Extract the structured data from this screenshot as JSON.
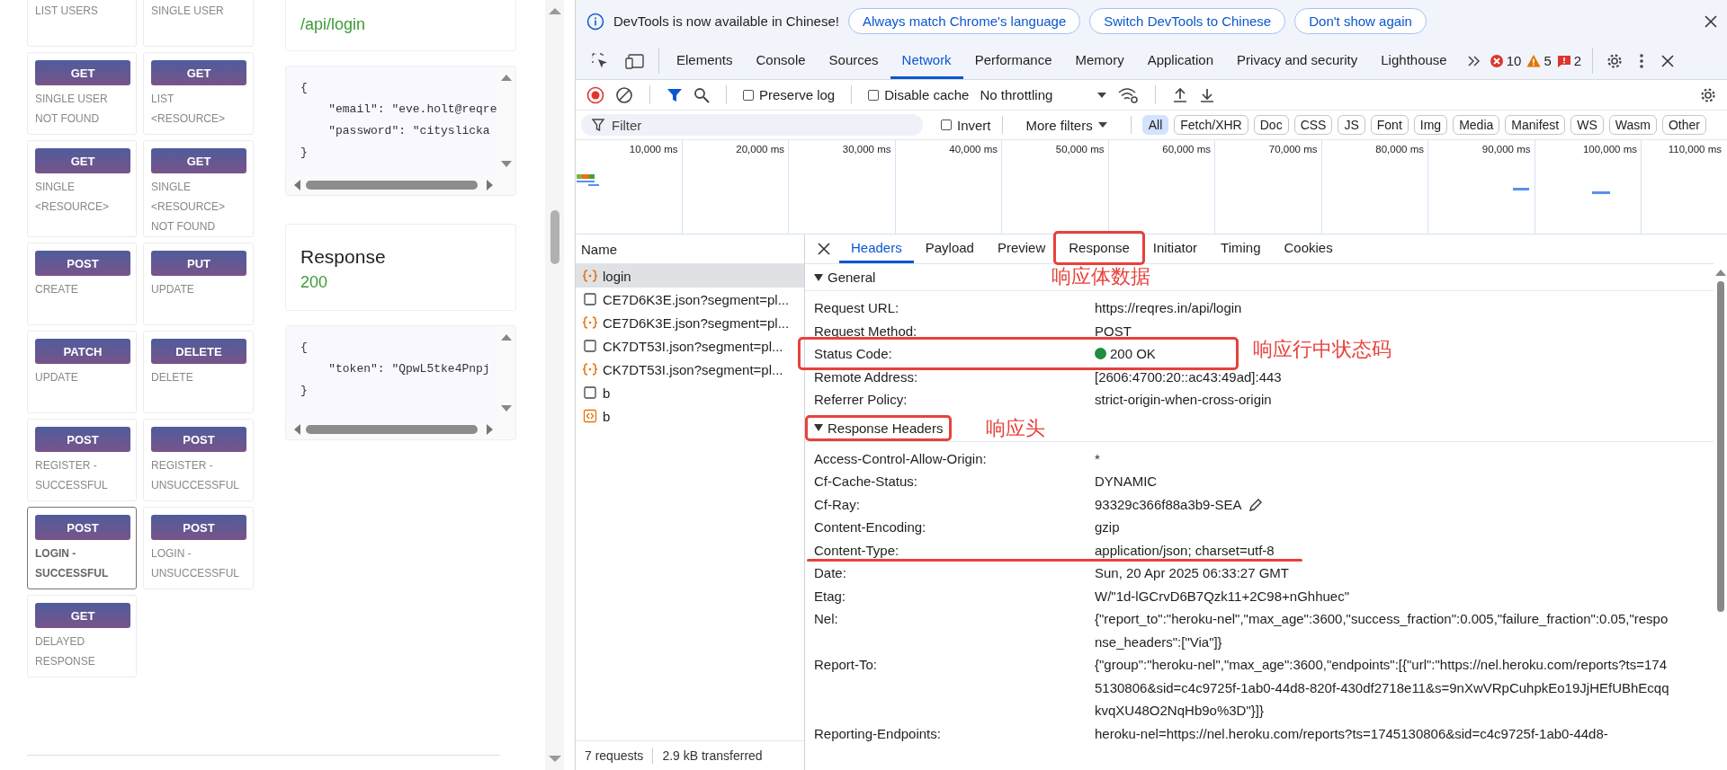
{
  "page": {
    "cards": [
      {
        "lines": "LIST USERS",
        "selected": false
      },
      {
        "lines": "SINGLE USER",
        "selected": false
      },
      {
        "method": "GET",
        "lines": "SINGLE USER NOT FOUND",
        "selected": false
      },
      {
        "method": "GET",
        "lines": "LIST <RESOURCE>",
        "selected": false
      },
      {
        "method": "GET",
        "lines": "SINGLE <RESOURCE>",
        "selected": false
      },
      {
        "method": "GET",
        "lines": "SINGLE <RESOURCE> NOT FOUND",
        "selected": false
      },
      {
        "method": "POST",
        "lines": "CREATE",
        "selected": false
      },
      {
        "method": "PUT",
        "lines": "UPDATE",
        "selected": false
      },
      {
        "method": "PATCH",
        "lines": "UPDATE",
        "selected": false
      },
      {
        "method": "DELETE",
        "lines": "DELETE",
        "selected": false
      },
      {
        "method": "POST",
        "lines": "REGISTER - SUCCESSFUL",
        "selected": false
      },
      {
        "method": "POST",
        "lines": "REGISTER - UNSUCCESSFUL",
        "selected": false
      },
      {
        "method": "POST",
        "lines": "LOGIN - SUCCESSFUL",
        "selected": true
      },
      {
        "method": "POST",
        "lines": "LOGIN - UNSUCCESSFUL",
        "selected": false
      },
      {
        "method": "GET",
        "lines": "DELAYED RESPONSE",
        "selected": false
      }
    ],
    "request": {
      "path": "/api/login",
      "body": [
        "{",
        "    \"email\": \"eve.holt@reqre",
        "    \"password\": \"cityslicka",
        "}"
      ]
    },
    "response": {
      "title": "Response",
      "status": "200",
      "body": [
        "{",
        "    \"token\": \"QpwL5tke4Pnpj",
        "}"
      ]
    }
  },
  "devtools": {
    "infobar": {
      "message": "DevTools is now available in Chinese!",
      "buttons": [
        "Always match Chrome's language",
        "Switch DevTools to Chinese",
        "Don't show again"
      ]
    },
    "tabs": [
      {
        "label": "Elements",
        "selected": false
      },
      {
        "label": "Console",
        "selected": false
      },
      {
        "label": "Sources",
        "selected": false
      },
      {
        "label": "Network",
        "selected": true
      },
      {
        "label": "Performance",
        "selected": false
      },
      {
        "label": "Memory",
        "selected": false
      },
      {
        "label": "Application",
        "selected": false
      },
      {
        "label": "Privacy and security",
        "selected": false
      },
      {
        "label": "Lighthouse",
        "selected": false
      }
    ],
    "issues": [
      {
        "kind": "error",
        "count": "10"
      },
      {
        "kind": "warning",
        "count": "5"
      },
      {
        "kind": "issue",
        "count": "2"
      }
    ],
    "toolbar": {
      "preserve_log": {
        "label": "Preserve log",
        "checked": false
      },
      "disable_cache": {
        "label": "Disable cache",
        "checked": false
      },
      "throttling": "No throttling"
    },
    "filter": {
      "placeholder": "Filter",
      "invert": {
        "label": "Invert",
        "checked": false
      },
      "more_filters": "More filters",
      "types": [
        {
          "label": "All",
          "selected": true
        },
        {
          "label": "Fetch/XHR",
          "selected": false
        },
        {
          "label": "Doc",
          "selected": false
        },
        {
          "label": "CSS",
          "selected": false
        },
        {
          "label": "JS",
          "selected": false
        },
        {
          "label": "Font",
          "selected": false
        },
        {
          "label": "Img",
          "selected": false
        },
        {
          "label": "Media",
          "selected": false
        },
        {
          "label": "Manifest",
          "selected": false
        },
        {
          "label": "WS",
          "selected": false
        },
        {
          "label": "Wasm",
          "selected": false
        },
        {
          "label": "Other",
          "selected": false
        }
      ]
    },
    "timeline": {
      "ticks": [
        "10,000 ms",
        "20,000 ms",
        "30,000 ms",
        "40,000 ms",
        "50,000 ms",
        "60,000 ms",
        "70,000 ms",
        "80,000 ms",
        "90,000 ms",
        "100,000 ms",
        "110,000 ms"
      ]
    },
    "requests": {
      "header": "Name",
      "rows": [
        {
          "name": "login",
          "kind": "fetch",
          "selected": true
        },
        {
          "name": "CE7D6K3E.json?segment=pl...",
          "kind": "blank",
          "selected": false
        },
        {
          "name": "CE7D6K3E.json?segment=pl...",
          "kind": "fetch",
          "selected": false
        },
        {
          "name": "CK7DT53I.json?segment=pl...",
          "kind": "blank",
          "selected": false
        },
        {
          "name": "CK7DT53I.json?segment=pl...",
          "kind": "fetch",
          "selected": false
        },
        {
          "name": "b",
          "kind": "blank",
          "selected": false
        },
        {
          "name": "b",
          "kind": "code",
          "selected": false
        }
      ],
      "footer": [
        "7 requests",
        "2.9 kB transferred"
      ]
    },
    "details": {
      "tabs": [
        {
          "label": "Headers",
          "selected": true
        },
        {
          "label": "Payload",
          "selected": false
        },
        {
          "label": "Preview",
          "selected": false
        },
        {
          "label": "Response",
          "selected": false,
          "note": "响应体数据"
        },
        {
          "label": "Initiator",
          "selected": false
        },
        {
          "label": "Timing",
          "selected": false
        },
        {
          "label": "Cookies",
          "selected": false
        }
      ],
      "sections": [
        {
          "title": "General",
          "expanded": true,
          "rows": [
            {
              "name": "Request URL:",
              "value": "https://reqres.in/api/login"
            },
            {
              "name": "Request Method:",
              "value": "POST"
            },
            {
              "name": "Status Code:",
              "value": "200 OK",
              "kind": "status",
              "note": "响应行中状态码"
            },
            {
              "name": "Remote Address:",
              "value": "[2606:4700:20::ac43:49ad]:443"
            },
            {
              "name": "Referrer Policy:",
              "value": "strict-origin-when-cross-origin"
            }
          ]
        },
        {
          "title": "Response Headers",
          "expanded": true,
          "note": "响应头",
          "rows": [
            {
              "name": "Access-Control-Allow-Origin:",
              "value": "*"
            },
            {
              "name": "Cf-Cache-Status:",
              "value": "DYNAMIC"
            },
            {
              "name": "Cf-Ray:",
              "value": "93329c366f88a3b9-SEA",
              "kind": "editable"
            },
            {
              "name": "Content-Encoding:",
              "value": "gzip"
            },
            {
              "name": "Content-Type:",
              "value": "application/json; charset=utf-8",
              "kind": "underlined"
            },
            {
              "name": "Date:",
              "value": "Sun, 20 Apr 2025 06:33:27 GMT"
            },
            {
              "name": "Etag:",
              "value": "W/\"1d-lGCrvD6B7Qzk11+2C98+nGhhuec\""
            },
            {
              "name": "Nel:",
              "value": "{\"report_to\":\"heroku-nel\",\"max_age\":3600,\"success_fraction\":0.005,\"failure_fraction\":0.05,\"response_headers\":[\"Via\"]}"
            },
            {
              "name": "Report-To:",
              "value": "{\"group\":\"heroku-nel\",\"max_age\":3600,\"endpoints\":[{\"url\":\"https://nel.heroku.com/reports?ts=1745130806&sid=c4c9725f-1ab0-44d8-820f-430df2718e11&s=9nXwVRpCuhpkEo19JjHEfUBhEcqqkvqXU48O2NqHb9o%3D\"}]}"
            },
            {
              "name": "Reporting-Endpoints:",
              "value": "heroku-nel=https://nel.heroku.com/reports?ts=1745130806&sid=c4c9725f-1ab0-44d8-"
            }
          ]
        }
      ]
    }
  }
}
